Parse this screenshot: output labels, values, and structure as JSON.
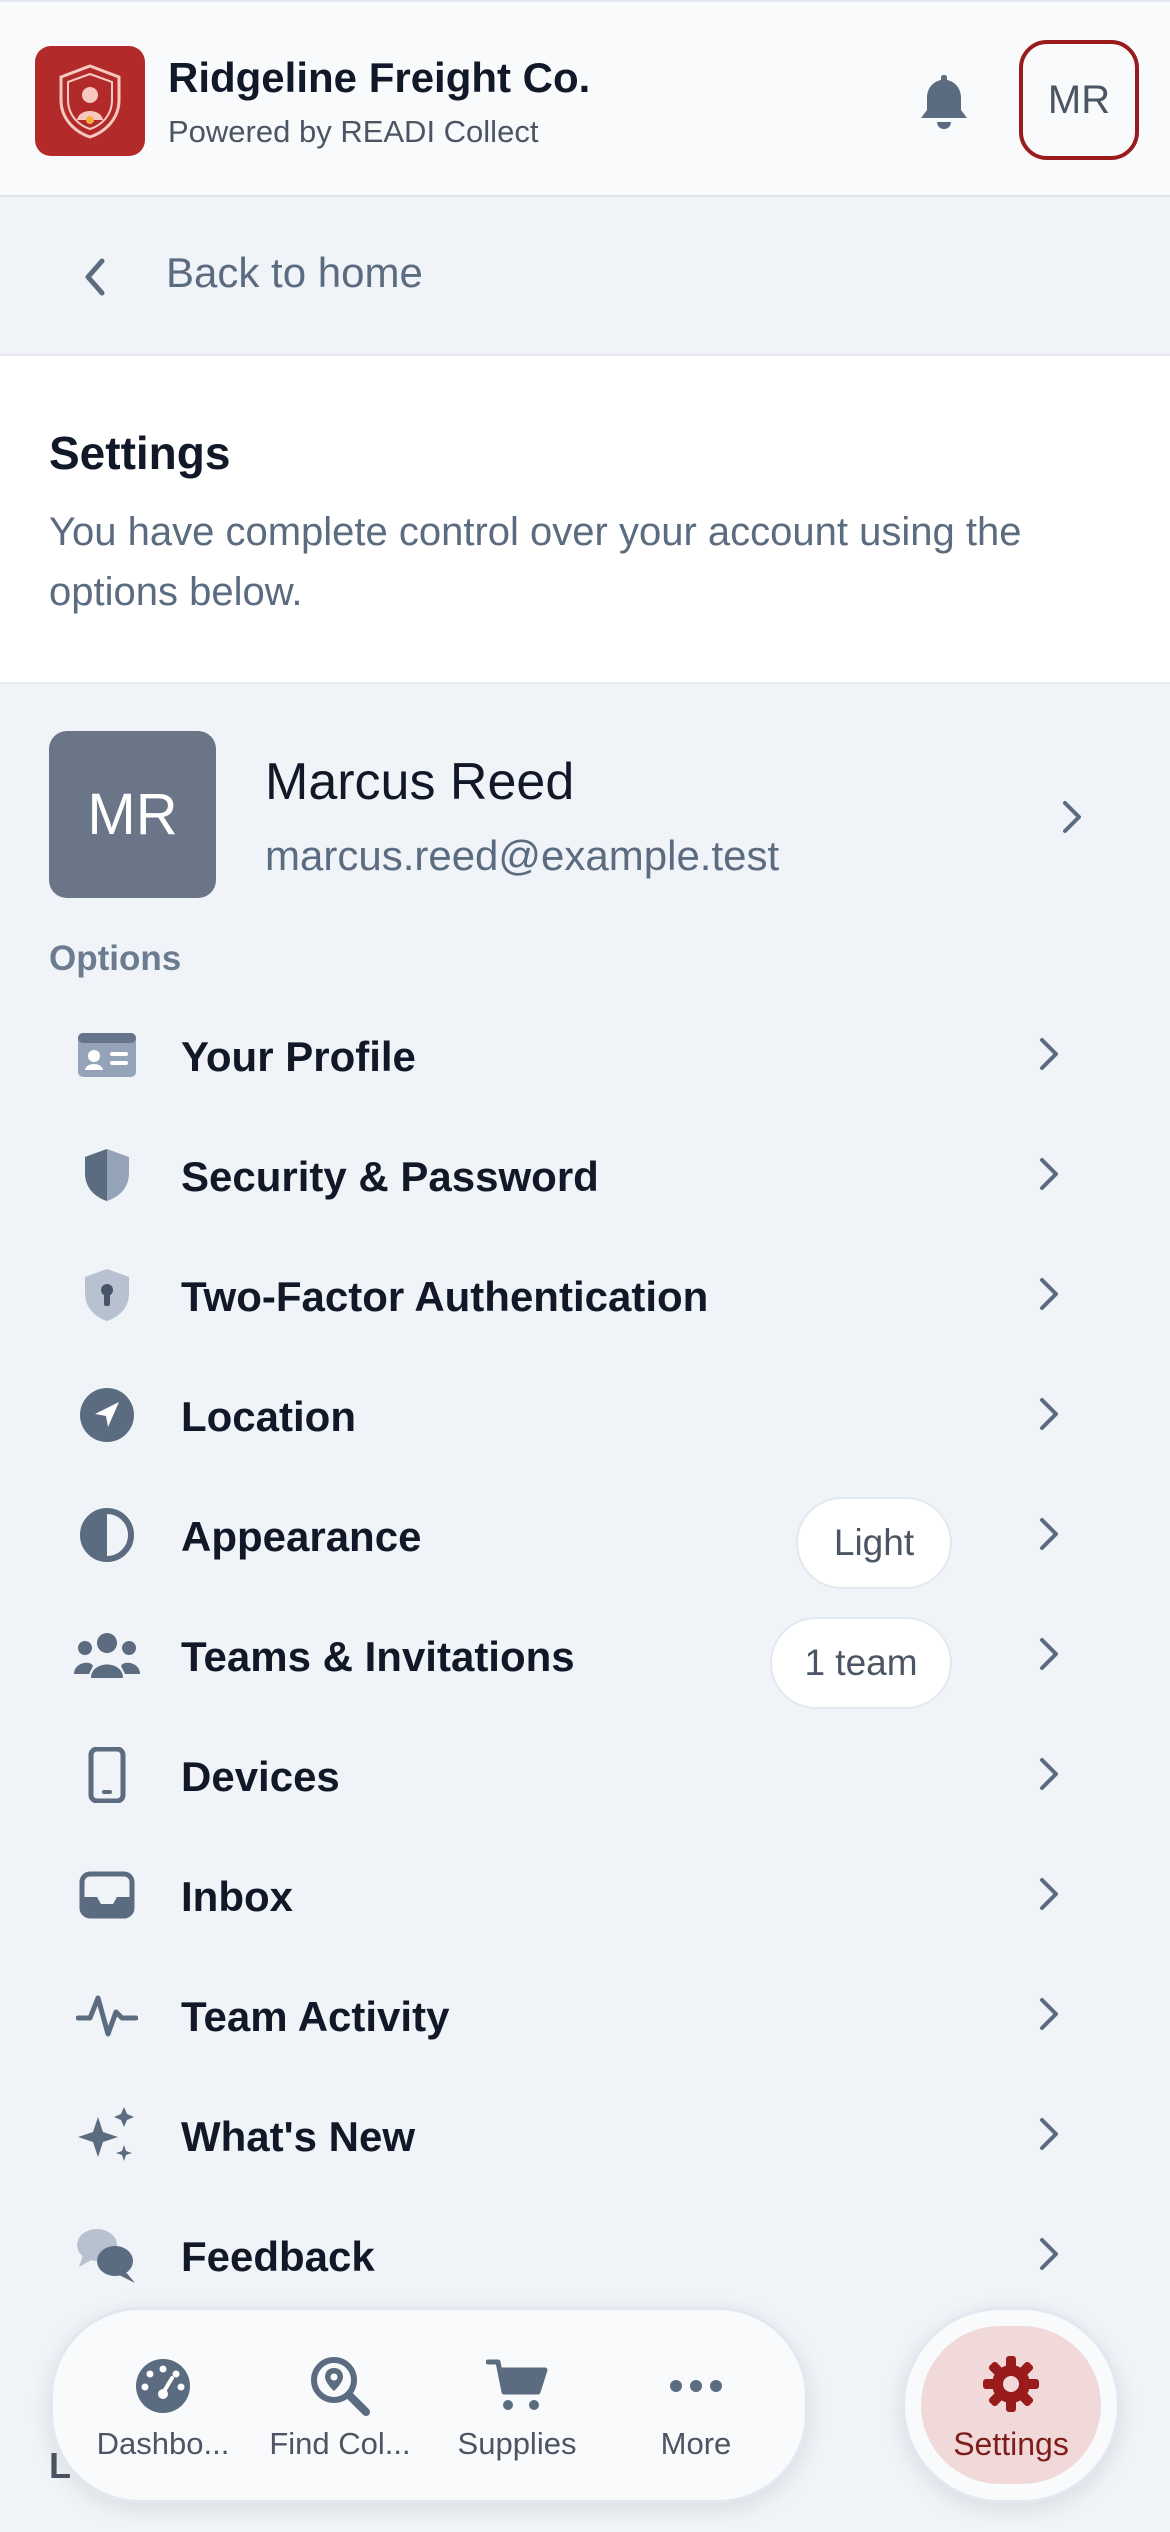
{
  "header": {
    "company": "Ridgeline Freight Co.",
    "powered_by": "Powered by READI Collect",
    "user_initials": "MR",
    "icons": {
      "logo": "shield-person-icon",
      "notifications": "bell-icon"
    },
    "colors": {
      "brand": "#b32a2a",
      "accent": "#991b1b"
    }
  },
  "back": {
    "label": "Back to home",
    "icon": "chevron-left-icon"
  },
  "settings": {
    "title": "Settings",
    "description": "You have complete control over your account using the options below."
  },
  "profile": {
    "initials": "MR",
    "name": "Marcus Reed",
    "email": "marcus.reed@example.test"
  },
  "options_label": "Options",
  "options": [
    {
      "label": "Your Profile",
      "icon": "id-card-icon",
      "badge": ""
    },
    {
      "label": "Security & Password",
      "icon": "shield-icon",
      "badge": ""
    },
    {
      "label": "Two-Factor Authentication",
      "icon": "shield-lock-icon",
      "badge": ""
    },
    {
      "label": "Location",
      "icon": "location-arrow-icon",
      "badge": ""
    },
    {
      "label": "Appearance",
      "icon": "contrast-icon",
      "badge": "Light"
    },
    {
      "label": "Teams & Invitations",
      "icon": "users-icon",
      "badge": "1 team"
    },
    {
      "label": "Devices",
      "icon": "mobile-device-icon",
      "badge": ""
    },
    {
      "label": "Inbox",
      "icon": "inbox-icon",
      "badge": ""
    },
    {
      "label": "Team Activity",
      "icon": "activity-icon",
      "badge": ""
    },
    {
      "label": "What's New",
      "icon": "sparkles-icon",
      "badge": ""
    },
    {
      "label": "Feedback",
      "icon": "chat-bubbles-icon",
      "badge": ""
    }
  ],
  "bottom_nav": {
    "items": [
      {
        "label": "Dashbo...",
        "icon": "gauge-icon"
      },
      {
        "label": "Find Col...",
        "icon": "search-location-icon"
      },
      {
        "label": "Supplies",
        "icon": "cart-icon"
      },
      {
        "label": "More",
        "icon": "more-dots-icon"
      }
    ],
    "active": {
      "label": "Settings",
      "icon": "gear-icon"
    }
  },
  "peek_letter": "L"
}
